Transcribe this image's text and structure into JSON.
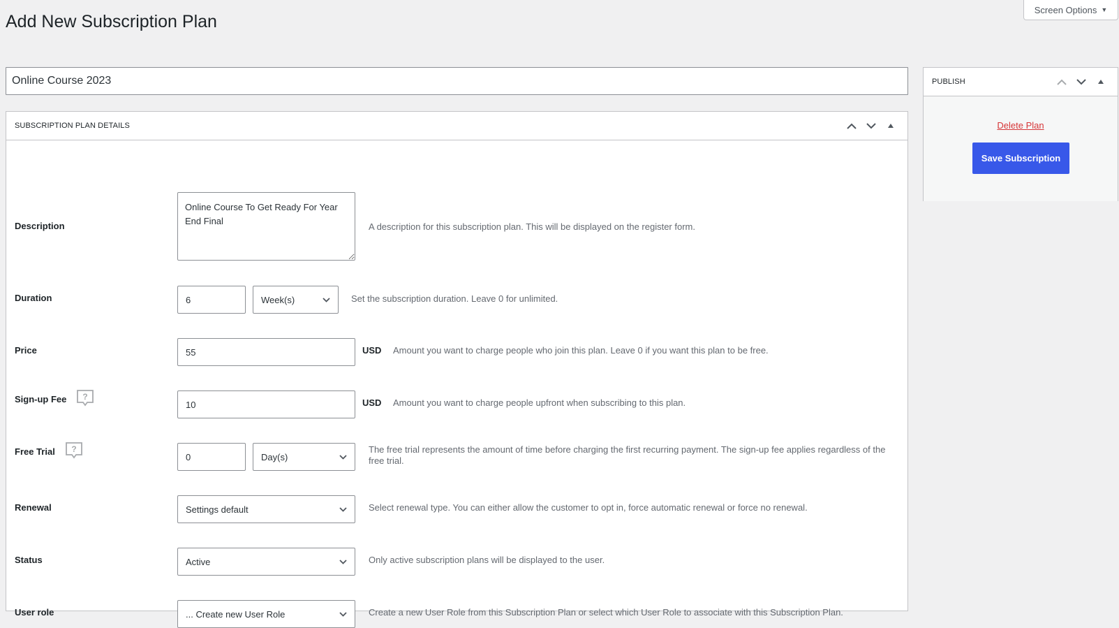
{
  "header": {
    "screen_options_label": "Screen Options",
    "page_title": "Add New Subscription Plan"
  },
  "plan": {
    "title_value": "Online Course 2023"
  },
  "details_box": {
    "title": "SUBSCRIPTION PLAN DETAILS",
    "fields": {
      "description": {
        "label": "Description",
        "value": "Online Course To Get Ready For Year End Final",
        "help": "A description for this subscription plan. This will be displayed on the register form."
      },
      "duration": {
        "label": "Duration",
        "value": "6",
        "unit": "Week(s)",
        "help": "Set the subscription duration. Leave 0 for unlimited."
      },
      "price": {
        "label": "Price",
        "value": "55",
        "currency": "USD",
        "help": "Amount you want to charge people who join this plan. Leave 0 if you want this plan to be free."
      },
      "signup_fee": {
        "label": "Sign-up Fee",
        "value": "10",
        "currency": "USD",
        "help": "Amount you want to charge people upfront when subscribing to this plan."
      },
      "free_trial": {
        "label": "Free Trial",
        "value": "0",
        "unit": "Day(s)",
        "help": "The free trial represents the amount of time before charging the first recurring payment. The sign-up fee applies regardless of the free trial."
      },
      "renewal": {
        "label": "Renewal",
        "value": "Settings default",
        "help": "Select renewal type. You can either allow the customer to opt in, force automatic renewal or force no renewal."
      },
      "status": {
        "label": "Status",
        "value": "Active",
        "help": "Only active subscription plans will be displayed to the user."
      },
      "user_role": {
        "label": "User role",
        "value": "... Create new User Role",
        "help": "Create a new User Role from this Subscription Plan or select which User Role to associate with this Subscription Plan."
      }
    }
  },
  "publish_box": {
    "title": "PUBLISH",
    "delete_label": "Delete Plan",
    "save_label": "Save Subscription"
  },
  "colors": {
    "primary_button": "#3858e9",
    "delete_link": "#d63638",
    "page_bg": "#f0f0f1"
  }
}
